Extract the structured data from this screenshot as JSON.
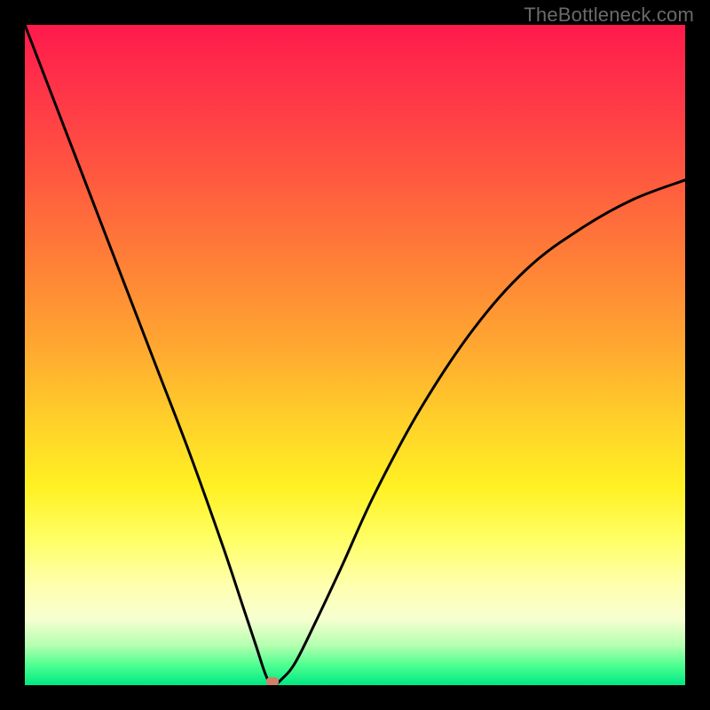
{
  "watermark": "TheBottleneck.com",
  "colors": {
    "background": "#000000",
    "curve": "#000000",
    "marker": "#d08068",
    "gradient_stops": [
      {
        "pos": 0.0,
        "hex": "#ff1a4b"
      },
      {
        "pos": 0.08,
        "hex": "#ff2f4a"
      },
      {
        "pos": 0.22,
        "hex": "#ff5640"
      },
      {
        "pos": 0.34,
        "hex": "#ff7a38"
      },
      {
        "pos": 0.48,
        "hex": "#ffa531"
      },
      {
        "pos": 0.6,
        "hex": "#ffd02a"
      },
      {
        "pos": 0.7,
        "hex": "#fff123"
      },
      {
        "pos": 0.78,
        "hex": "#ffff66"
      },
      {
        "pos": 0.85,
        "hex": "#ffffb0"
      },
      {
        "pos": 0.9,
        "hex": "#f6ffd0"
      },
      {
        "pos": 0.94,
        "hex": "#b4ffb0"
      },
      {
        "pos": 0.97,
        "hex": "#4dff90"
      },
      {
        "pos": 1.0,
        "hex": "#00e884"
      }
    ]
  },
  "chart_data": {
    "type": "line",
    "title": "",
    "xlabel": "",
    "ylabel": "",
    "xlim": [
      0,
      1
    ],
    "ylim": [
      0,
      1
    ],
    "note": "Axes are normalized 0–1 over the plot area; (0,0) is bottom-left. Background gradient encodes bottleneck severity (red=high, green=low). Curve is a V-shaped mismatch/bottleneck curve with its minimum near x≈0.375. Marker indicates the curve's minimum point.",
    "series": [
      {
        "name": "bottleneck-curve",
        "x": [
          0.0,
          0.05,
          0.1,
          0.15,
          0.2,
          0.25,
          0.3,
          0.33,
          0.35,
          0.365,
          0.375,
          0.39,
          0.41,
          0.44,
          0.48,
          0.53,
          0.6,
          0.68,
          0.76,
          0.84,
          0.92,
          1.0
        ],
        "y": [
          1.0,
          0.87,
          0.74,
          0.61,
          0.48,
          0.35,
          0.21,
          0.12,
          0.06,
          0.015,
          0.0,
          0.01,
          0.035,
          0.095,
          0.18,
          0.29,
          0.42,
          0.54,
          0.63,
          0.69,
          0.735,
          0.765
        ]
      }
    ],
    "marker": {
      "x": 0.375,
      "y": 0.0
    }
  }
}
